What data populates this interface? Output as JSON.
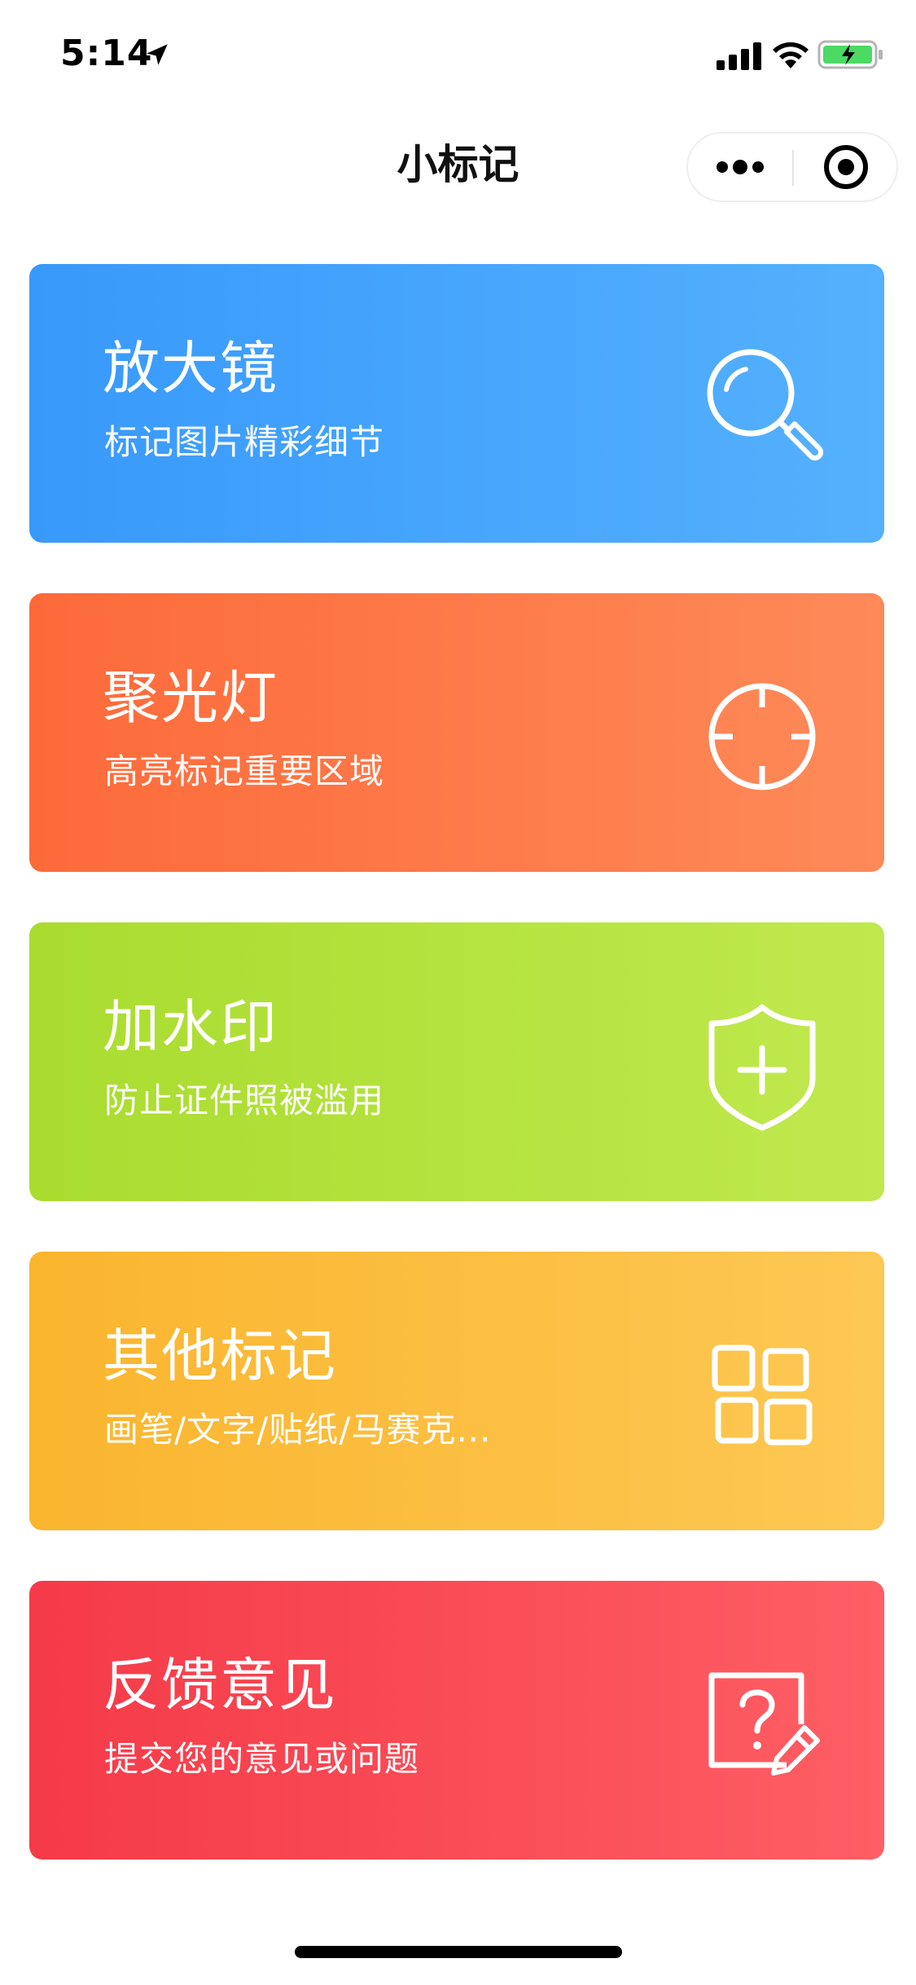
{
  "status_bar": {
    "time": "5:14",
    "icons": [
      "location-arrow-icon",
      "cellular-signal-icon",
      "wifi-icon",
      "battery-charging-icon"
    ],
    "battery_color": "#4cd964"
  },
  "nav": {
    "title": "小标记",
    "capsule_icons": [
      "more-dots-icon",
      "close-target-icon"
    ]
  },
  "cards": [
    {
      "title": "放大镜",
      "subtitle": "标记图片精彩细节",
      "icon": "magnifier-icon",
      "colors": [
        "#3899fb",
        "#55b1fd"
      ]
    },
    {
      "title": "聚光灯",
      "subtitle": "高亮标记重要区域",
      "icon": "crosshair-icon",
      "colors": [
        "#fd6a3a",
        "#fe8a59"
      ]
    },
    {
      "title": "加水印",
      "subtitle": "防止证件照被滥用",
      "icon": "shield-plus-icon",
      "colors": [
        "#a9dc2f",
        "#c0e94e"
      ]
    },
    {
      "title": "其他标记",
      "subtitle": "画笔/文字/贴纸/马赛克...",
      "icon": "grid-icon",
      "colors": [
        "#fab52e",
        "#fdc854"
      ]
    },
    {
      "title": "反馈意见",
      "subtitle": "提交您的意见或问题",
      "icon": "feedback-edit-icon",
      "colors": [
        "#f53a49",
        "#fe5e65"
      ]
    }
  ]
}
